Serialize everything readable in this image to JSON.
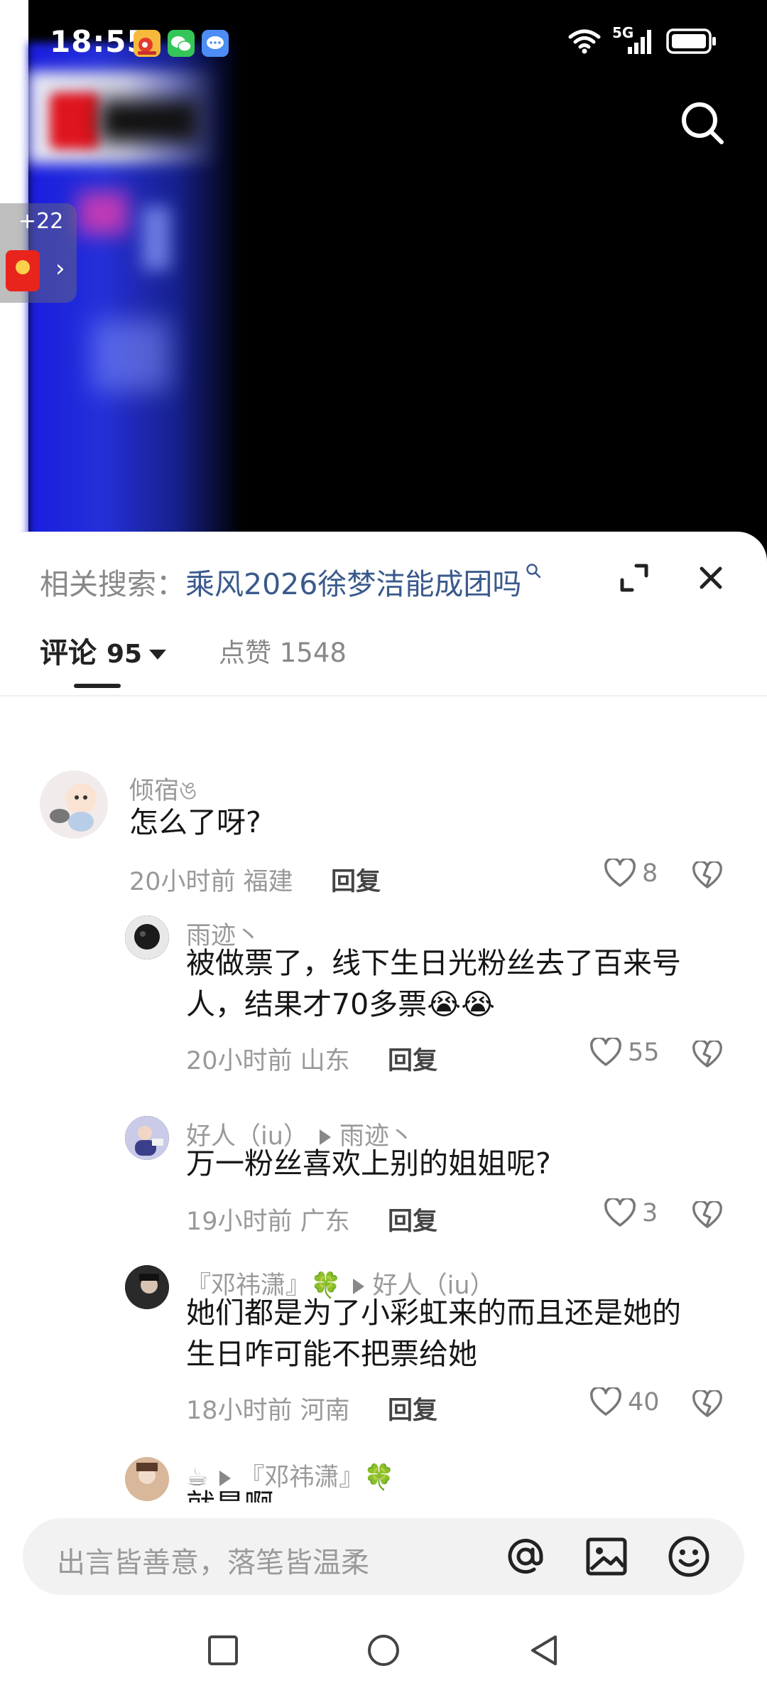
{
  "status_bar": {
    "time": "18:55",
    "network": "5G"
  },
  "float_widget": {
    "count": "+22"
  },
  "related_search": {
    "prefix": "相关搜索：",
    "term": "乘风2026徐梦洁能成团吗"
  },
  "tabs": {
    "comments_label": "评论",
    "comments_count": "95",
    "likes_label": "点赞 1548"
  },
  "comments": [
    {
      "name": "倾宿ঙ",
      "text": "怎么了呀?",
      "meta": "20小时前 福建",
      "reply": "回复",
      "likes": "8"
    },
    {
      "name": "雨迹丶",
      "text_line1": "被做票了，线下生日光粉丝去了百来号",
      "text_line2": "人，结果才70多票😭😭",
      "meta": "20小时前 山东",
      "reply": "回复",
      "likes": "55"
    },
    {
      "name": "好人（iu）",
      "reply_to": "雨迹丶",
      "text": "万一粉丝喜欢上别的姐姐呢?",
      "meta": "19小时前 广东",
      "reply": "回复",
      "likes": "3"
    },
    {
      "name": "『邓祎潇』🍀",
      "reply_to": "好人（iu）",
      "text_line1": "她们都是为了小彩虹来的而且还是她的",
      "text_line2": "生日咋可能不把票给她",
      "meta": "18小时前 河南",
      "reply": "回复",
      "likes": "40"
    },
    {
      "name": "☕",
      "reply_to": "『邓祎潇』🍀",
      "text": "就是啊"
    }
  ],
  "input": {
    "placeholder": "出言皆善意，落笔皆温柔"
  },
  "icons": {
    "search": "search-icon",
    "expand": "expand-icon",
    "close": "close-icon",
    "at": "at-icon",
    "image": "image-icon",
    "emoji": "emoji-icon"
  }
}
